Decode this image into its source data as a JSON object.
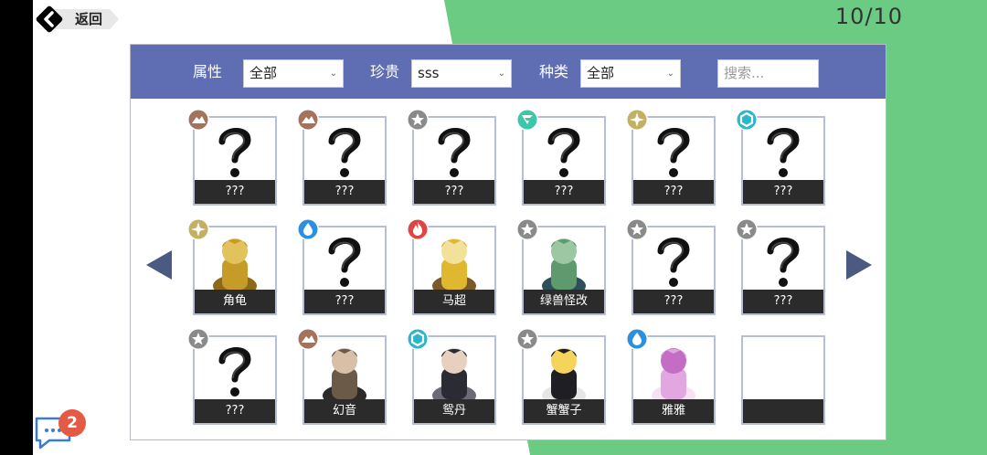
{
  "header": {
    "back_label": "返回",
    "counter": "10/10"
  },
  "filters": {
    "attribute_label": "属性",
    "attribute_value": "全部",
    "rarity_label": "珍贵",
    "rarity_value": "sss",
    "type_label": "种类",
    "type_value": "全部",
    "search_placeholder": "搜索..."
  },
  "cards": [
    {
      "name": "???",
      "element": "earth-icon",
      "art": "question"
    },
    {
      "name": "???",
      "element": "earth-icon",
      "art": "question"
    },
    {
      "name": "???",
      "element": "star-icon",
      "art": "question"
    },
    {
      "name": "???",
      "element": "wind-icon",
      "art": "question"
    },
    {
      "name": "???",
      "element": "light-icon",
      "art": "question"
    },
    {
      "name": "???",
      "element": "hexagon-icon",
      "art": "question"
    },
    {
      "name": "角龟",
      "element": "light-icon",
      "art": "turtle-character"
    },
    {
      "name": "???",
      "element": "water-icon",
      "art": "question"
    },
    {
      "name": "马超",
      "element": "fire-icon",
      "art": "warrior-character"
    },
    {
      "name": "绿兽怪改",
      "element": "star-icon",
      "art": "green-orc-character"
    },
    {
      "name": "???",
      "element": "star-icon",
      "art": "question"
    },
    {
      "name": "???",
      "element": "star-icon",
      "art": "question"
    },
    {
      "name": "???",
      "element": "star-icon",
      "art": "question"
    },
    {
      "name": "幻音",
      "element": "earth-icon",
      "art": "girl-character"
    },
    {
      "name": "鸳丹",
      "element": "hexagon-icon",
      "art": "dark-warrior-character"
    },
    {
      "name": "蟹蟹子",
      "element": "star-icon",
      "art": "umbrella-girl-character"
    },
    {
      "name": "雅雅",
      "element": "water-icon",
      "art": "pink-hair-girl-character"
    },
    {
      "name": "",
      "element": "",
      "art": "empty"
    }
  ],
  "chat": {
    "count": "2"
  },
  "colors": {
    "filter_bar": "#5f6eb3",
    "green": "#6ccb82",
    "earth": "#a3735c",
    "star": "#8a8a8a",
    "wind": "#3dc7a9",
    "light": "#c3b062",
    "hexagon": "#2bb6c9",
    "water": "#2d8fe0",
    "fire": "#e04545"
  }
}
